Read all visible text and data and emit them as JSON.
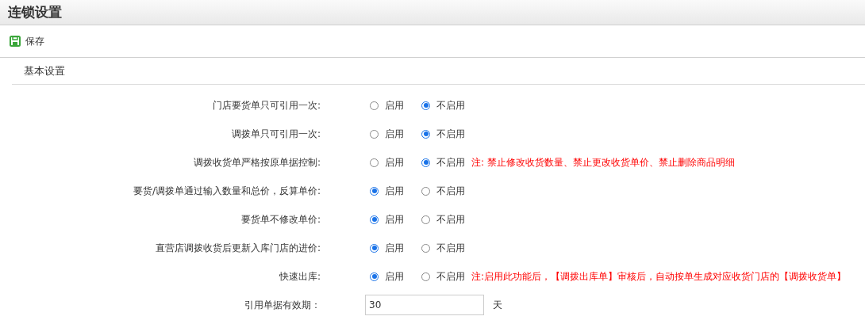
{
  "window": {
    "title": "连锁设置"
  },
  "toolbar": {
    "save_label": "保存"
  },
  "section": {
    "title": "基本设置"
  },
  "settings": [
    {
      "kind": "radio",
      "label": "门店要货单只可引用一次:",
      "options": [
        {
          "label": "启用",
          "selected": false
        },
        {
          "label": "不启用",
          "selected": true
        }
      ]
    },
    {
      "kind": "radio",
      "label": "调拨单只可引用一次:",
      "options": [
        {
          "label": "启用",
          "selected": false
        },
        {
          "label": "不启用",
          "selected": true
        }
      ]
    },
    {
      "kind": "radio",
      "label": "调拨收货单严格按原单据控制:",
      "options": [
        {
          "label": "启用",
          "selected": false
        },
        {
          "label": "不启用",
          "selected": true
        }
      ],
      "note": "注: 禁止修改收货数量、禁止更改收货单价、禁止删除商品明细"
    },
    {
      "kind": "radio",
      "label": "要货/调拨单通过输入数量和总价，反算单价:",
      "options": [
        {
          "label": "启用",
          "selected": true
        },
        {
          "label": "不启用",
          "selected": false
        }
      ]
    },
    {
      "kind": "radio",
      "label": "要货单不修改单价:",
      "options": [
        {
          "label": "启用",
          "selected": true
        },
        {
          "label": "不启用",
          "selected": false
        }
      ]
    },
    {
      "kind": "radio",
      "label": "直营店调拨收货后更新入库门店的进价:",
      "options": [
        {
          "label": "启用",
          "selected": true
        },
        {
          "label": "不启用",
          "selected": false
        }
      ]
    },
    {
      "kind": "radio",
      "label": "快速出库:",
      "options": [
        {
          "label": "启用",
          "selected": true
        },
        {
          "label": "不启用",
          "selected": false
        }
      ],
      "note": "注:启用此功能后，【调拨出库单】审核后，自动按单生成对应收货门店的【调拨收货单】"
    },
    {
      "kind": "input",
      "label": "引用单据有效期：",
      "value": "30",
      "unit": "天"
    }
  ]
}
